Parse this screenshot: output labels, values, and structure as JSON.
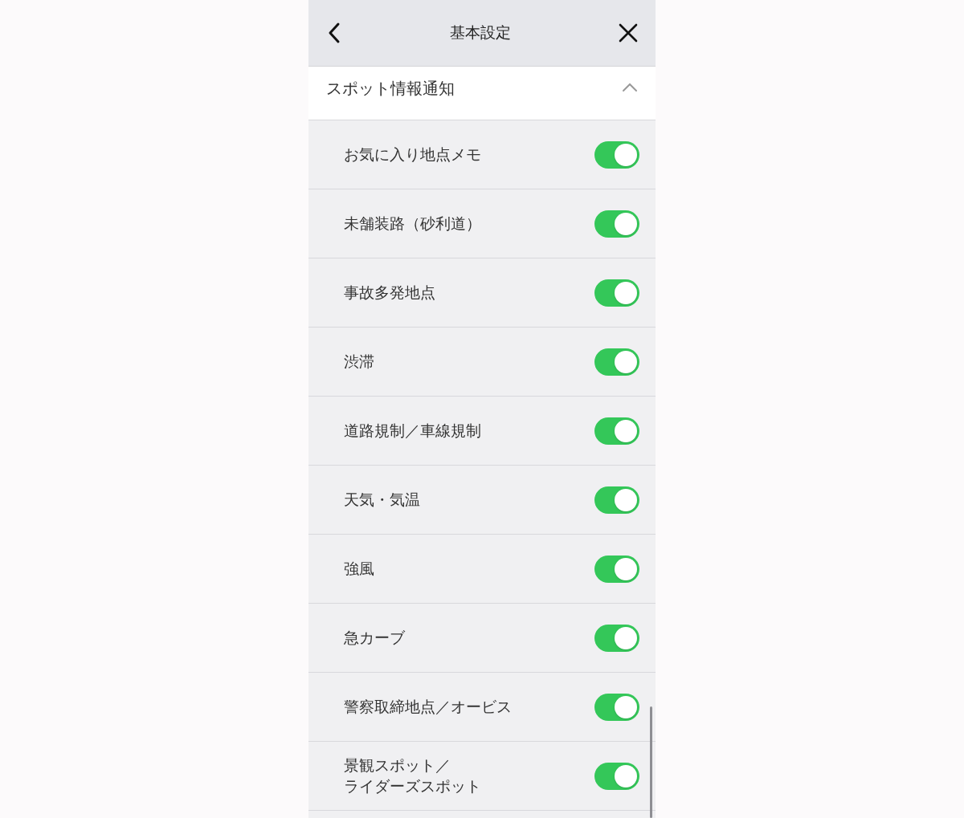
{
  "header": {
    "title": "基本設定"
  },
  "section": {
    "title": "スポット情報通知",
    "expanded": true
  },
  "items": [
    {
      "label": "お気に入り地点メモ",
      "on": true
    },
    {
      "label": "未舗装路（砂利道）",
      "on": true
    },
    {
      "label": "事故多発地点",
      "on": true
    },
    {
      "label": "渋滞",
      "on": true
    },
    {
      "label": "道路規制／車線規制",
      "on": true
    },
    {
      "label": "天気・気温",
      "on": true
    },
    {
      "label": "強風",
      "on": true
    },
    {
      "label": "急カーブ",
      "on": true
    },
    {
      "label": "警察取締地点／オービス",
      "on": true
    },
    {
      "lines": [
        "景観スポット／",
        "ライダーズスポット"
      ],
      "on": true
    }
  ]
}
